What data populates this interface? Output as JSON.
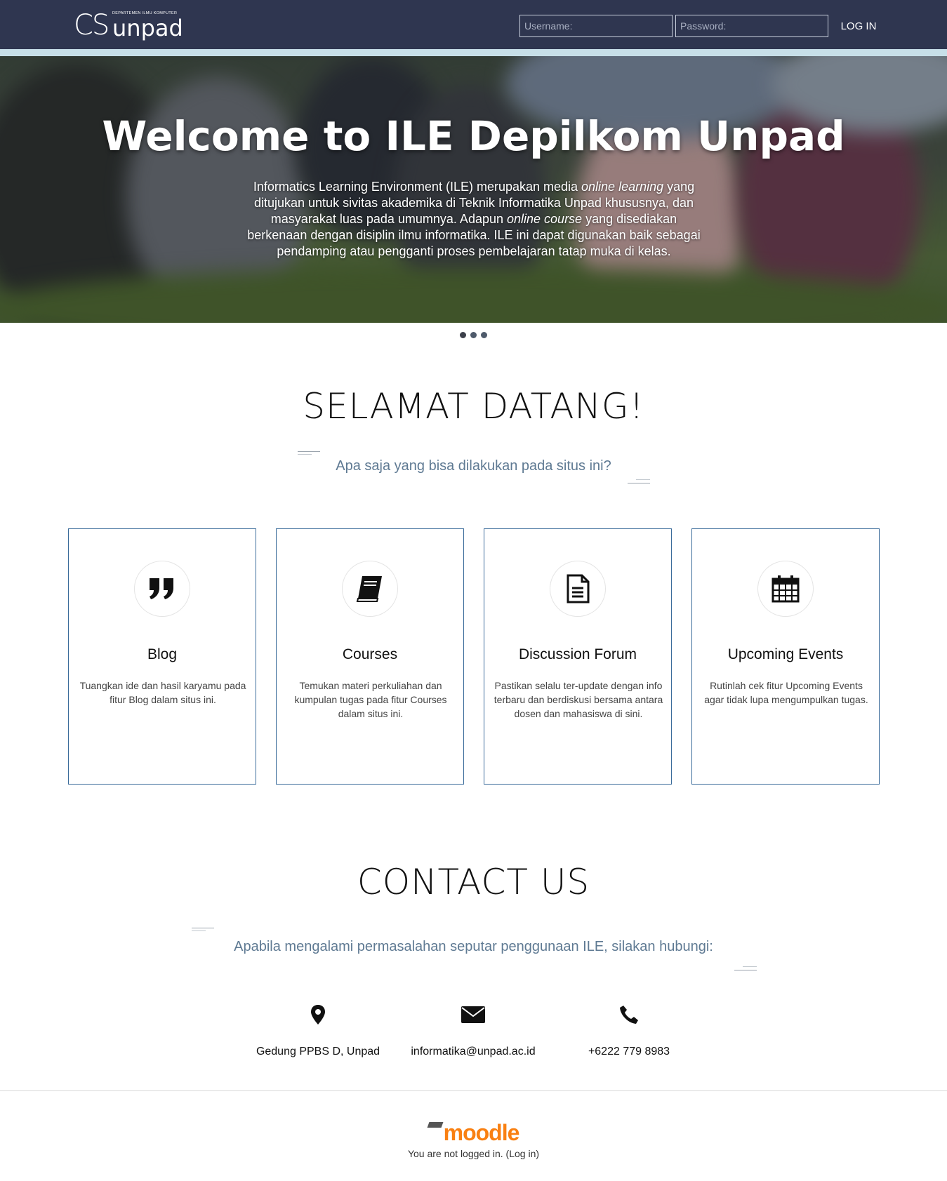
{
  "header": {
    "logo_main": "CS",
    "logo_sub": "DEPARTEMEN ILMU KOMPUTER",
    "logo_unpad": "unpad",
    "username_placeholder": "Username:",
    "password_placeholder": "Password:",
    "login_label": "LOG IN"
  },
  "hero": {
    "title": "Welcome to ILE Depilkom Unpad",
    "text_1": "Informatics Learning Environment (ILE) merupakan media ",
    "text_em1": "online learning",
    "text_2": " yang ditujukan untuk sivitas akademika di Teknik Informatika Unpad khususnya, dan masyarakat luas pada umumnya. Adapun ",
    "text_em2": "online course",
    "text_3": " yang disediakan berkenaan dengan disiplin ilmu informatika. ILE ini dapat digunakan baik sebagai pendamping atau pengganti proses pembelajaran tatap muka di kelas.",
    "slide_count": 3,
    "active_slide": 1
  },
  "welcome": {
    "title": "SELAMAT DATANG!",
    "subtitle": "Apa saja yang bisa dilakukan pada situs ini?"
  },
  "features": [
    {
      "icon": "quote-icon",
      "title": "Blog",
      "desc": "Tuangkan ide dan hasil karyamu pada fitur Blog dalam situs ini."
    },
    {
      "icon": "book-icon",
      "title": "Courses",
      "desc": "Temukan materi perkuliahan dan kumpulan tugas pada fitur Courses dalam situs ini."
    },
    {
      "icon": "document-icon",
      "title": "Discussion Forum",
      "desc": "Pastikan selalu ter-update dengan info terbaru dan berdiskusi bersama antara dosen dan mahasiswa di sini."
    },
    {
      "icon": "calendar-icon",
      "title": "Upcoming Events",
      "desc": "Rutinlah cek fitur Upcoming Events agar tidak lupa mengumpulkan tugas."
    }
  ],
  "contact": {
    "title": "CONTACT US",
    "subtitle": "Apabila mengalami permasalahan seputar penggunaan ILE, silakan hubungi:",
    "items": [
      {
        "icon": "map-marker-icon",
        "text": "Gedung PPBS D, Unpad"
      },
      {
        "icon": "envelope-icon",
        "text": "informatika@unpad.ac.id"
      },
      {
        "icon": "phone-icon",
        "text": "+6222 779 8983"
      }
    ]
  },
  "footer": {
    "brand": "moodle",
    "status_text": "You are not logged in. (",
    "login_link": "Log in",
    "status_end": ")"
  },
  "colors": {
    "header_bg": "#2f3650",
    "accent_strip": "#c7dfe8",
    "card_border": "#3a6b9a",
    "subtitle": "#5f7a93",
    "moodle_orange": "#f98012"
  }
}
